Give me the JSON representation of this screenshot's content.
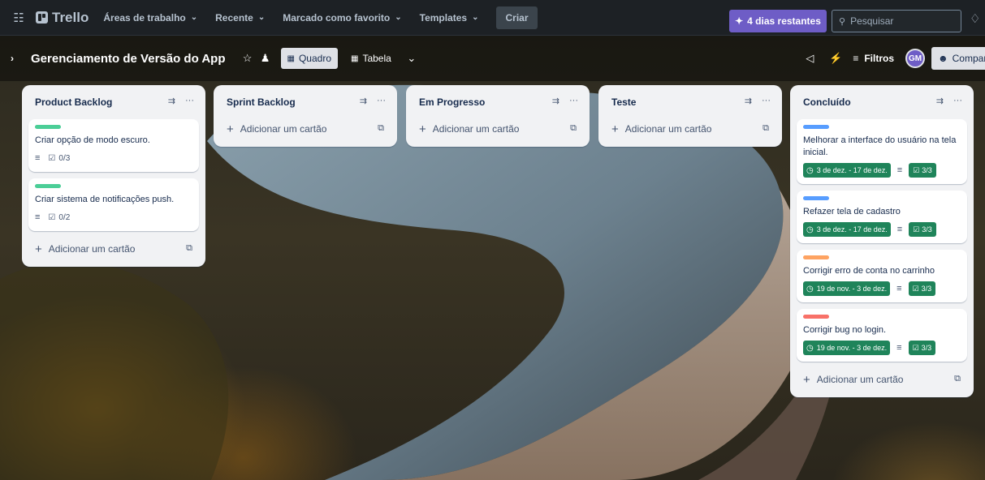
{
  "nav": {
    "apps_icon": "grid-icon",
    "logo": "Trello",
    "menus": [
      {
        "label": "Áreas de trabalho"
      },
      {
        "label": "Recente"
      },
      {
        "label": "Marcado como favorito"
      },
      {
        "label": "Templates"
      }
    ],
    "create": "Criar",
    "trial": "4 dias restantes",
    "search_placeholder": "Pesquisar"
  },
  "board": {
    "title": "Gerenciamento de Versão do App",
    "views": [
      {
        "label": "Quadro",
        "active": true
      },
      {
        "label": "Tabela",
        "active": false
      }
    ],
    "filters": "Filtros",
    "avatar": "GM",
    "share": "Compartilhar"
  },
  "lists": [
    {
      "title": "Product Backlog",
      "cards": [
        {
          "label_color": "#4bce97",
          "title": "Criar opção de modo escuro.",
          "checklist": "0/3"
        },
        {
          "label_color": "#4bce97",
          "title": "Criar sistema de notificações push.",
          "checklist": "0/2"
        }
      ],
      "add_card": "Adicionar um cartão"
    },
    {
      "title": "Sprint Backlog",
      "cards": [],
      "add_card": "Adicionar um cartão"
    },
    {
      "title": "Em Progresso",
      "cards": [],
      "add_card": "Adicionar um cartão"
    },
    {
      "title": "Teste",
      "cards": [],
      "add_card": "Adicionar um cartão"
    },
    {
      "title": "Concluído",
      "cards": [
        {
          "label_color": "#579dff",
          "title": "Melhorar a interface do usuário na tela inicial.",
          "dates": "3 de dez. - 17 de dez.",
          "checklist": "3/3"
        },
        {
          "label_color": "#579dff",
          "title": "Refazer tela de cadastro",
          "dates": "3 de dez. - 17 de dez.",
          "checklist": "3/3"
        },
        {
          "label_color": "#fea362",
          "title": "Corrigir erro de conta no carrinho",
          "dates": "19 de nov. - 3 de dez.",
          "checklist": "3/3"
        },
        {
          "label_color": "#f87168",
          "title": "Corrigir bug no login.",
          "dates": "19 de nov. - 3 de dez.",
          "checklist": "3/3"
        }
      ],
      "add_card": "Adicionar um cartão"
    }
  ]
}
